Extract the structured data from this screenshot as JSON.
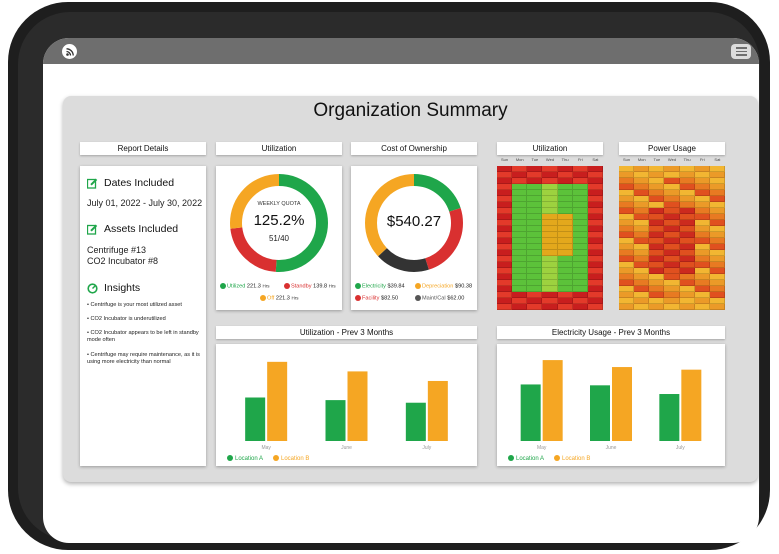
{
  "title": "Organization Summary",
  "report": {
    "header": "Report Details",
    "dates_title": "Dates Included",
    "dates_value": "July 01, 2022 - July 30, 2022",
    "assets_title": "Assets Included",
    "assets": [
      "Centrifuge #13",
      "CO2 Incubator #8"
    ],
    "insights_title": "Insights",
    "insights": [
      "Centrifuge is your most utilized asset",
      "CO2 Incubator is underutilized",
      "CO2 Incubator appears to be left in standby mode often",
      "Centrifuge may require maintenance, as it is using more electricity than normal"
    ]
  },
  "utilization": {
    "header": "Utilization",
    "quota_label": "WEEKLY QUOTA",
    "percent": "125.2%",
    "fraction": "51/40",
    "legend": [
      {
        "label": "Utilized",
        "value": "221.3",
        "unit": "Hrs",
        "color": "#1fa64a"
      },
      {
        "label": "Standby",
        "value": "139.8",
        "unit": "Hrs",
        "color": "#d93030"
      },
      {
        "label": "Off",
        "value": "221.3",
        "unit": "Hrs",
        "color": "#f5a623"
      }
    ],
    "ring": [
      {
        "color": "#1fa64a",
        "fraction": 0.51
      },
      {
        "color": "#d93030",
        "fraction": 0.22
      },
      {
        "color": "#f5a623",
        "fraction": 0.27
      }
    ]
  },
  "cost": {
    "header": "Cost of Ownership",
    "total": "$540.27",
    "legend": [
      {
        "label": "Electricity",
        "value": "$39.84",
        "color": "#1fa64a"
      },
      {
        "label": "Depreciation",
        "value": "$90.38",
        "color": "#f5a623"
      },
      {
        "label": "Facility",
        "value": "$82.50",
        "color": "#d93030"
      },
      {
        "label": "Maint/Cal",
        "value": "$62.00",
        "color": "#555555"
      }
    ],
    "ring": [
      {
        "color": "#1fa64a",
        "fraction": 0.2
      },
      {
        "color": "#d93030",
        "fraction": 0.25
      },
      {
        "color": "#333333",
        "fraction": 0.18
      },
      {
        "color": "#f5a623",
        "fraction": 0.37
      }
    ]
  },
  "heatmaps": {
    "days": [
      "Sun",
      "Mon",
      "Tue",
      "Wed",
      "Thu",
      "Fri",
      "Sat"
    ],
    "utilization_header": "Utilization",
    "power_header": "Power Usage",
    "utilization_palette": [
      "#c81e1e",
      "#e33a2a",
      "#5cc23a",
      "#9dd23f",
      "#e3a81c"
    ],
    "power_palette": [
      "#f2b632",
      "#eb9a28",
      "#e87a22",
      "#e0501f",
      "#cc2a1e"
    ]
  },
  "util_chart": {
    "header": "Utilization - Prev 3 Months",
    "chart_data": {
      "type": "bar",
      "categories": [
        "May",
        "June",
        "July"
      ],
      "series": [
        {
          "name": "Location A",
          "values": [
            50,
            47,
            44
          ],
          "color": "#1fa64a"
        },
        {
          "name": "Location B",
          "values": [
            91,
            80,
            69
          ],
          "color": "#f5a623"
        }
      ],
      "ylim": [
        0,
        100
      ],
      "legend": "bottom-left"
    }
  },
  "elec_chart": {
    "header": "Electricity Usage - Prev 3 Months",
    "chart_data": {
      "type": "bar",
      "categories": [
        "May",
        "June",
        "July"
      ],
      "series": [
        {
          "name": "Location A",
          "values": [
            65,
            64,
            54
          ],
          "color": "#1fa64a"
        },
        {
          "name": "Location B",
          "values": [
            93,
            85,
            82
          ],
          "color": "#f5a623"
        }
      ],
      "ylim": [
        0,
        100
      ],
      "legend": "bottom-left"
    }
  }
}
